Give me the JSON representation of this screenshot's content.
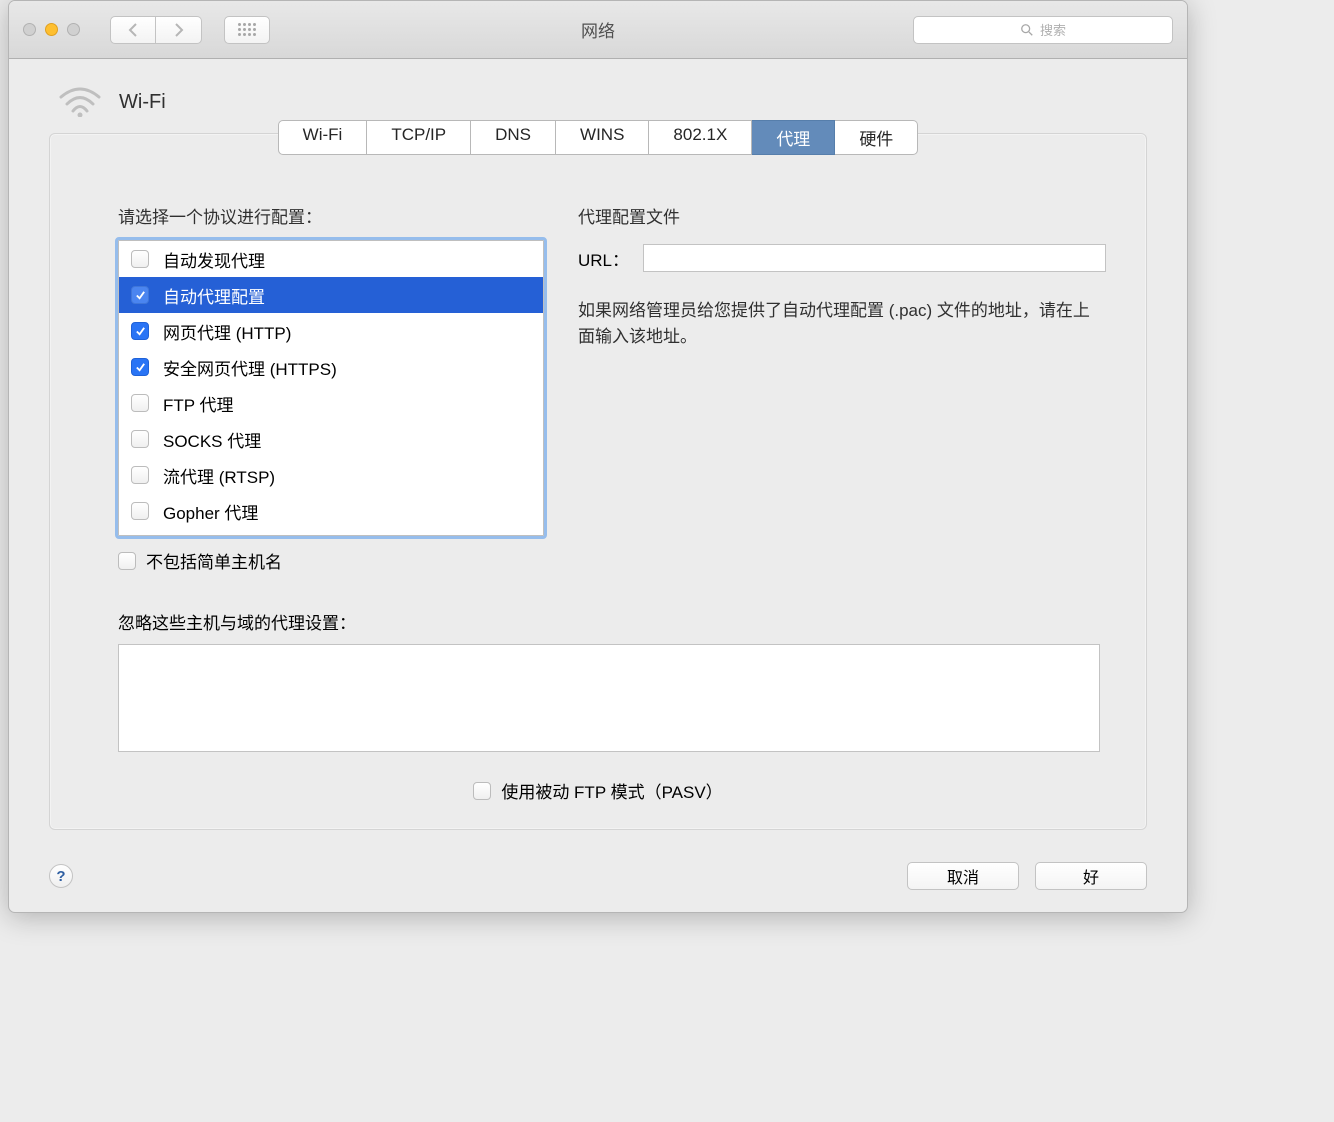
{
  "window": {
    "title": "网络"
  },
  "search": {
    "placeholder": "搜索"
  },
  "header": {
    "title": "Wi-Fi"
  },
  "tabs": [
    {
      "label": "Wi-Fi",
      "selected": false
    },
    {
      "label": "TCP/IP",
      "selected": false
    },
    {
      "label": "DNS",
      "selected": false
    },
    {
      "label": "WINS",
      "selected": false
    },
    {
      "label": "802.1X",
      "selected": false
    },
    {
      "label": "代理",
      "selected": true
    },
    {
      "label": "硬件",
      "selected": false
    }
  ],
  "left": {
    "label": "请选择一个协议进行配置：",
    "protocols": [
      {
        "label": "自动发现代理",
        "checked": false,
        "selected": false
      },
      {
        "label": "自动代理配置",
        "checked": true,
        "selected": true
      },
      {
        "label": "网页代理 (HTTP)",
        "checked": true,
        "selected": false
      },
      {
        "label": "安全网页代理 (HTTPS)",
        "checked": true,
        "selected": false
      },
      {
        "label": "FTP 代理",
        "checked": false,
        "selected": false
      },
      {
        "label": "SOCKS 代理",
        "checked": false,
        "selected": false
      },
      {
        "label": "流代理  (RTSP)",
        "checked": false,
        "selected": false
      },
      {
        "label": "Gopher 代理",
        "checked": false,
        "selected": false
      }
    ],
    "exclude_simple_hosts": {
      "label": "不包括简单主机名",
      "checked": false
    }
  },
  "right": {
    "title": "代理配置文件",
    "url_label": "URL：",
    "url_value": "",
    "hint": "如果网络管理员给您提供了自动代理配置 (.pac) 文件的地址，请在上面输入该地址。"
  },
  "bypass": {
    "label": "忽略这些主机与域的代理设置：",
    "value": ""
  },
  "pasv": {
    "label": "使用被动 FTP 模式（PASV）",
    "checked": false
  },
  "footer": {
    "cancel": "取消",
    "ok": "好",
    "help": "?"
  }
}
